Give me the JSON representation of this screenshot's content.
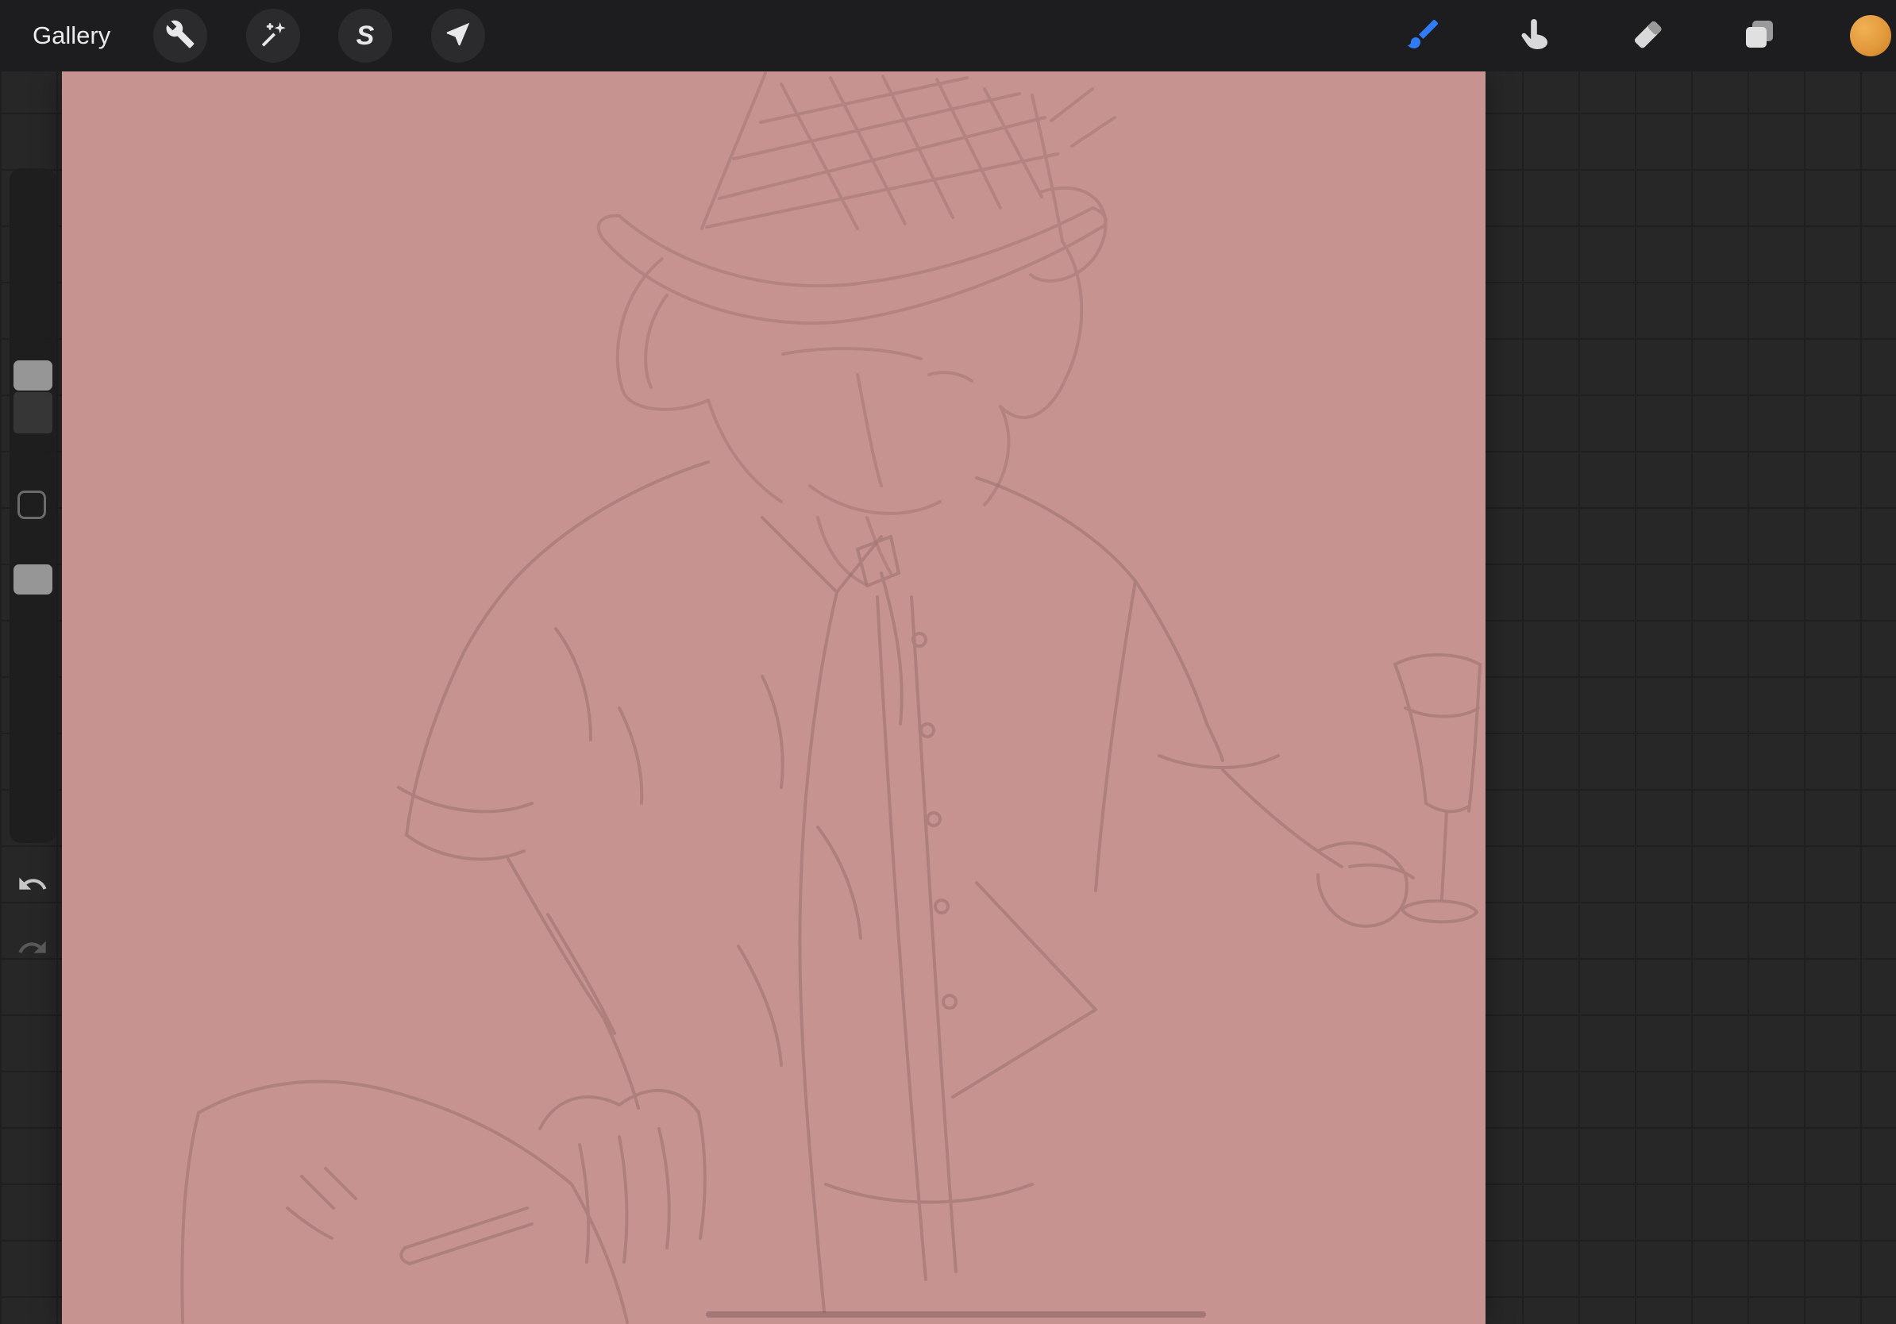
{
  "app_title": "Procreate canvas workspace",
  "topbar": {
    "gallery_label": "Gallery",
    "tools_left": [
      {
        "id": "actions",
        "icon": "wrench-icon"
      },
      {
        "id": "adjustments",
        "icon": "magic-wand-icon"
      },
      {
        "id": "selection",
        "icon": "selection-s-icon",
        "glyph": "S"
      },
      {
        "id": "transform",
        "icon": "transform-arrow-icon"
      }
    ],
    "tools_right": [
      {
        "id": "paint",
        "icon": "paintbrush-icon",
        "active": true
      },
      {
        "id": "smudge",
        "icon": "smudge-finger-icon",
        "active": false
      },
      {
        "id": "erase",
        "icon": "eraser-icon",
        "active": false
      },
      {
        "id": "layers",
        "icon": "layers-icon",
        "active": false
      },
      {
        "id": "color",
        "icon": "color-swatch",
        "active": false
      }
    ]
  },
  "sidebar": {
    "size_slider": "brush-size-slider",
    "modify_button": "modify-button",
    "opacity_slider": "brush-opacity-slider",
    "undo": {
      "icon": "undo-arrow-icon",
      "enabled": true
    },
    "redo": {
      "icon": "redo-arrow-icon",
      "enabled": false
    }
  },
  "canvas": {
    "description": "Rough sketch of an anthropomorphic character wearing a crosshatched top hat, collared vest with buttons and tie, holding a wine glass in one hand and a cigar in the other, on a dusty rose background"
  },
  "colors": {
    "topbar-bg": "#1d1d1f",
    "workspace-bg": "#272727",
    "grid-line": "#1f1f1f",
    "canvas-bg": "#c69390",
    "sketch-line": "#9a7170",
    "accent-blue": "#2f7cf6",
    "swatch-orange": "#e2993b",
    "sidebar-bg": "#1e1e1e",
    "handle-gray": "#9b9b9b"
  }
}
